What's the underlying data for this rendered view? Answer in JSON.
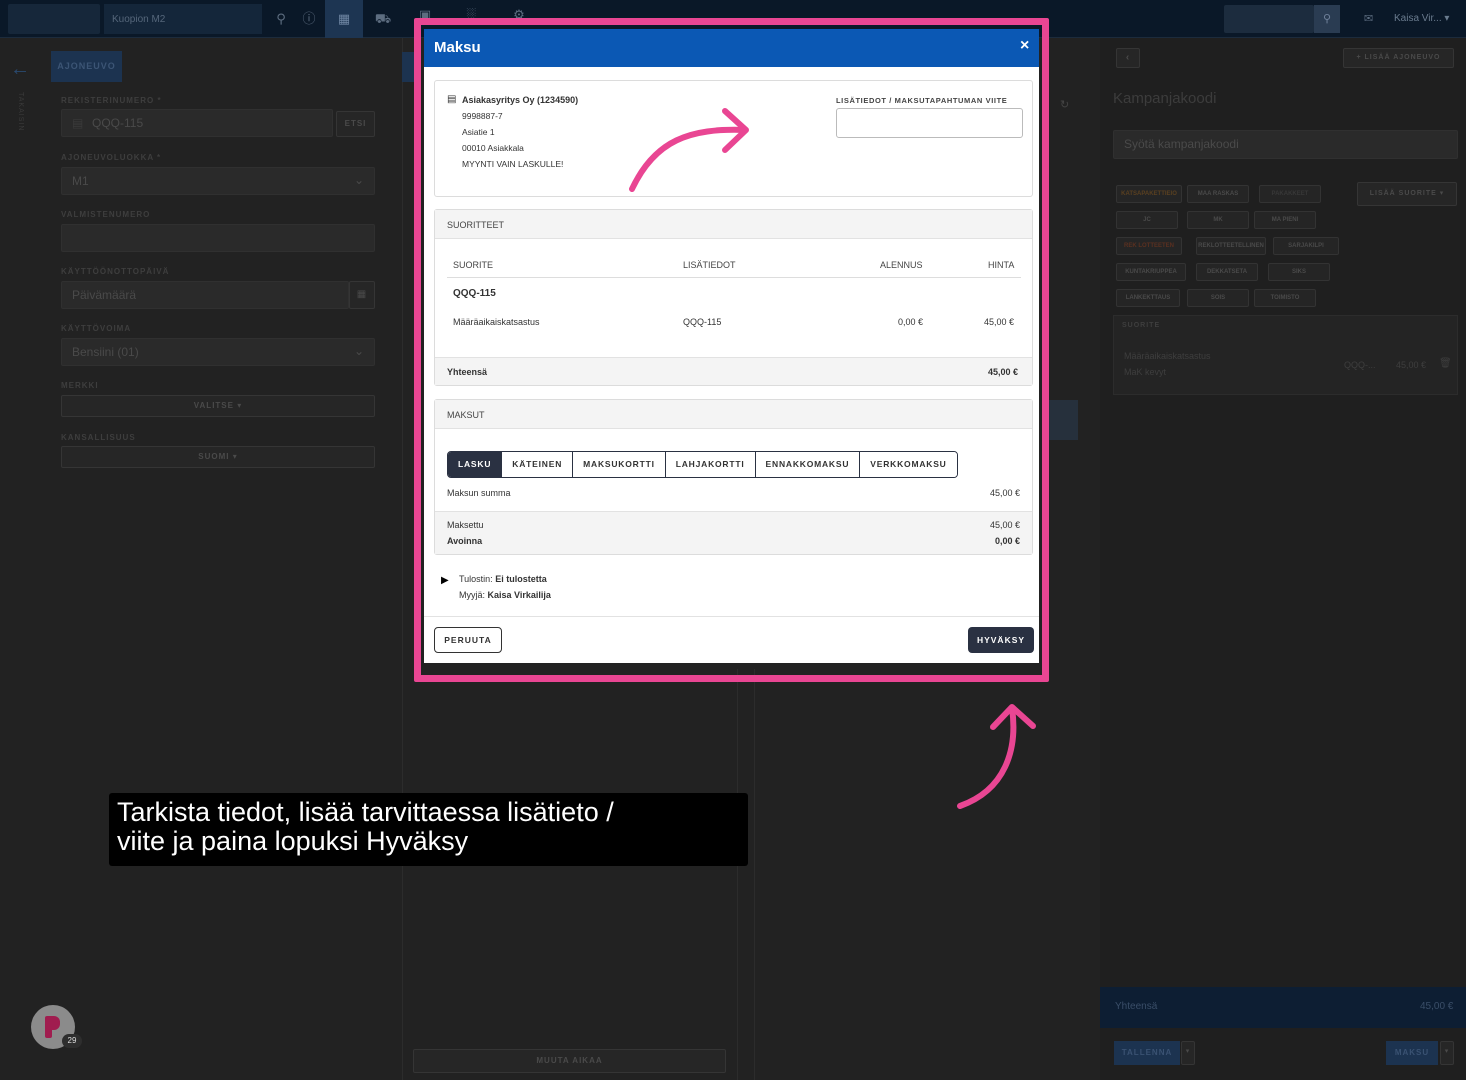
{
  "topbar": {
    "context_label": "Kuopion M2",
    "user_label": "Kaisa Vir...",
    "icons": [
      "search-icon",
      "info-icon",
      "calendar-icon",
      "car-icon",
      "box-icon",
      "chart-icon",
      "wrench-icon"
    ]
  },
  "left_panel": {
    "vehicle_tab": "AJONEUVO",
    "side_label": "TAKAISIN",
    "reg_label": "REKISTERINUMERO *",
    "reg_value": "QQQ-115",
    "search_btn": "ETSI",
    "class_label": "AJONEUVOLUOKKA *",
    "class_value": "M1",
    "vin_label": "VALMISTENUMERO",
    "date_label": "KÄYTTÖÖNOTTOPÄIVÄ",
    "date_placeholder": "Päivämäärä",
    "fuel_label": "KÄYTTÖVOIMA",
    "fuel_value": "Bensiini (01)",
    "brand_label": "MERKKI",
    "brand_btn": "VALITSE",
    "nation_label": "KANSALLISUUS",
    "nation_btn": "SUOMI"
  },
  "middle_panel": {
    "change_time_btn": "MUUTA AIKAA"
  },
  "right_panel": {
    "add_vehicle_btn": "+ LISÄÄ AJONEUVO",
    "campaign_title": "Kampanjakoodi",
    "campaign_placeholder": "Syötä kampanjakoodi",
    "add_service_btn": "LISÄÄ SUORITE",
    "chips": [
      [
        "KATSAPAKETTIEIO",
        "MAA RASKAS",
        "PAKAKKEET"
      ],
      [
        "JC",
        "MK",
        "MA PIENI"
      ],
      [
        "REK LOTTEETEN",
        "REKLOTTEETELLINEN",
        "SARJAKILPI"
      ],
      [
        "KUNTAKRIUPPEA",
        "DEKKATSETA",
        "SIKS"
      ],
      [
        "LANKEKTTAUS",
        "SOIS",
        "TOIMISTO"
      ]
    ],
    "services_header": "SUORITE",
    "service_name": "Määräaikaiskatsastus",
    "service_sub": "MaK kevyt",
    "service_ref": "QQQ-...",
    "service_price": "45,00 €",
    "total_label": "Yhteensä",
    "total_value": "45,00 €",
    "save_btn": "TALLENNA",
    "pay_btn": "MAKSU"
  },
  "modal": {
    "title": "Maksu",
    "close": "×",
    "customer": {
      "name": "Asiakasyritys Oy (1234590)",
      "lines": [
        "9998887-7",
        "Asiatie 1",
        "00010 Asiakkala",
        "MYYNTI VAIN LASKULLE!"
      ]
    },
    "reference_label": "LISÄTIEDOT / MAKSUTAPAHTUMAN VIITE",
    "reference_value": "",
    "services": {
      "header": "SUORITTEET",
      "columns": [
        "SUORITE",
        "LISÄTIEDOT",
        "ALENNUS",
        "HINTA"
      ],
      "group": "QQQ-115",
      "rows": [
        {
          "name": "Määräaikaiskatsastus",
          "info": "QQQ-115",
          "discount": "0,00 €",
          "price": "45,00 €"
        }
      ],
      "total_label": "Yhteensä",
      "total_value": "45,00 €"
    },
    "payments": {
      "header": "MAKSUT",
      "tabs": [
        "LASKU",
        "KÄTEINEN",
        "MAKSUKORTTI",
        "LAHJAKORTTI",
        "ENNAKKOMAKSU",
        "VERKKOMAKSU"
      ],
      "active_tab": "LASKU",
      "sum_label": "Maksun summa",
      "sum_value": "45,00 €",
      "paid_label": "Maksettu",
      "paid_value": "45,00 €",
      "open_label": "Avoinna",
      "open_value": "0,00 €"
    },
    "printer_label": "Tulostin:",
    "printer_value": "Ei tulostetta",
    "seller_label": "Myyjä:",
    "seller_value": "Kaisa Virkailija",
    "cancel_btn": "PERUUTA",
    "accept_btn": "HYVÄKSY"
  },
  "caption": {
    "line1": "Tarkista tiedot, lisää tarvittaessa lisätieto /",
    "line2": "viite ja paina lopuksi Hyväksy"
  },
  "badge_count": "29",
  "colors": {
    "highlight": "#e94693",
    "modal_header": "#0b58b4",
    "dark_button": "#2a3142"
  }
}
